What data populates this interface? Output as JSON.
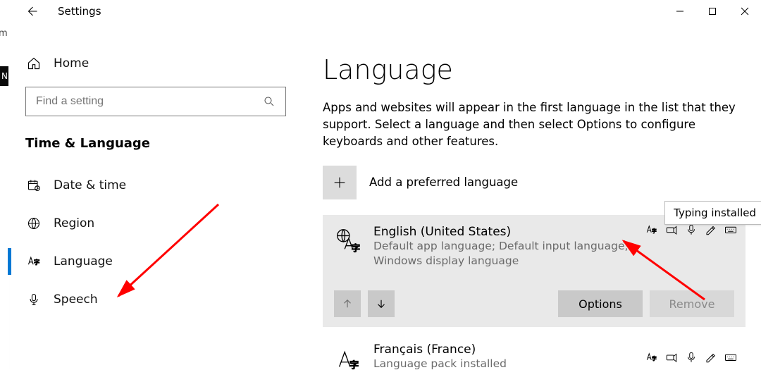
{
  "appTitle": "Settings",
  "search": {
    "placeholder": "Find a setting"
  },
  "section": "Time & Language",
  "sidebar": {
    "home": "Home",
    "items": [
      {
        "label": "Date & time"
      },
      {
        "label": "Region"
      },
      {
        "label": "Language"
      },
      {
        "label": "Speech"
      }
    ]
  },
  "page": {
    "title": "Language",
    "description": "Apps and websites will appear in the first language in the list that they support. Select a language and then select Options to configure keyboards and other features.",
    "addLabel": "Add a preferred language",
    "tooltip": "Typing installed",
    "languages": [
      {
        "name": "English (United States)",
        "subLine1": "Default app language; Default input language;",
        "subLine2": "Windows display language"
      },
      {
        "name": "Français (France)",
        "subLine1": "Language pack installed"
      }
    ],
    "actions": {
      "options": "Options",
      "remove": "Remove"
    }
  },
  "browserFragment": {
    "address": "m",
    "tab": "N"
  }
}
